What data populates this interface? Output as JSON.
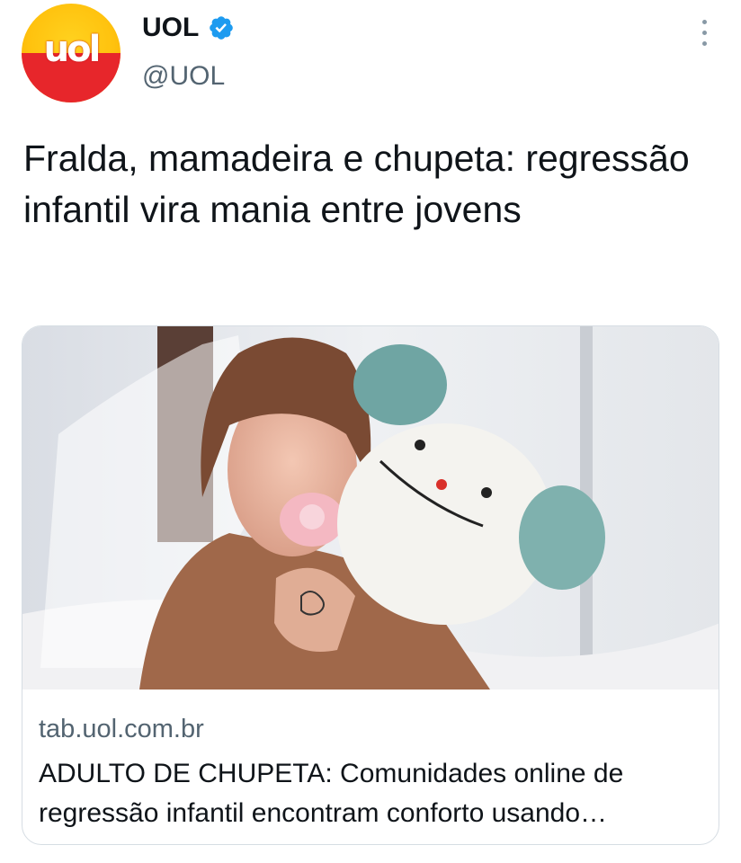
{
  "author": {
    "display_name": "UOL",
    "handle": "@UOL",
    "avatar_text": "uol",
    "verified_icon": "verified-badge-icon"
  },
  "menu_icon": "more-vertical-icon",
  "tweet": {
    "text": "Fralda, mamadeira e chupeta: regressão infantil vira mania entre jovens"
  },
  "link_card": {
    "image_icon": "article-photo",
    "domain": "tab.uol.com.br",
    "title": "ADULTO DE CHUPETA: Comunidades online de regressão infantil encontram conforto usando…"
  },
  "colors": {
    "verified": "#1d9bf0",
    "muted_text": "#536471",
    "logo_yellow": "#ffc20e",
    "logo_red": "#e7262b"
  }
}
